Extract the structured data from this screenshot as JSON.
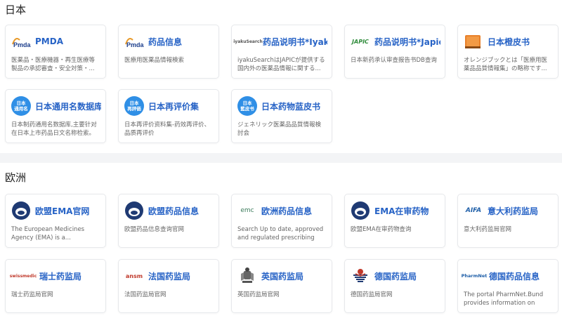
{
  "japan": {
    "title": "日本",
    "cards": [
      {
        "title": "PMDA",
        "desc": "医薬品・医療機器・再生医療等製品の承認審査・安全対策・...",
        "icon": "pmda-logo"
      },
      {
        "title": "药品信息",
        "desc": "医療用医薬品情報検索",
        "icon": "pmda-logo"
      },
      {
        "title": "药品说明书*Iyaku",
        "desc": "iyakuSearchはJAPICが提供する国内外の医薬品情報に関する...",
        "icon": "iyakusearch-logo",
        "logo_text": "iyakuSearch"
      },
      {
        "title": "药品说明书*Japic",
        "desc": "日本新药承认审查报告书DB查询",
        "icon": "japic-logo",
        "logo_text": "JAPIC"
      },
      {
        "title": "日本橙皮书",
        "desc": "オレンジブックとは「医療用医薬品品質情報集」の略称です...",
        "icon": "orange-book-logo"
      },
      {
        "title": "日本通用名数据库",
        "desc": "日本制药通用名数据库,主要针对在日本上市药品日文名称检索。",
        "icon": "generic-name-logo",
        "logo_text": "日本\n通用名"
      },
      {
        "title": "日本再评价集",
        "desc": "日本再评价资料集-药效再评价、品质再评价",
        "icon": "reevaluation-logo",
        "logo_text": "日本\n再評価"
      },
      {
        "title": "日本药物蓝皮书",
        "desc": "ジェネリック医薬品品質情報検討会",
        "icon": "blue-book-logo",
        "logo_text": "日本\n藍皮书"
      }
    ]
  },
  "europe": {
    "title": "欧洲",
    "cards": [
      {
        "title": "欧盟EMA官网",
        "desc": "The European Medicines Agency (EMA) is a...",
        "icon": "ema-logo"
      },
      {
        "title": "欧盟药品信息",
        "desc": "欧盟药品信息查询官网",
        "icon": "ema-logo"
      },
      {
        "title": "欧洲药品信息",
        "desc": "Search Up to date, approved and regulated prescribing an...",
        "icon": "emc-logo",
        "logo_text": "emc"
      },
      {
        "title": "EMA在审药物",
        "desc": "欧盟EMA在审药物查询",
        "icon": "ema-logo"
      },
      {
        "title": "意大利药监局",
        "desc": "意大利药监局官网",
        "icon": "aifa-logo",
        "logo_text": "AIFA"
      },
      {
        "title": "瑞士药监局",
        "desc": "瑞士药监局官网",
        "icon": "swissmedic-logo",
        "logo_text": "swissmedic"
      },
      {
        "title": "法国药监局",
        "desc": "法国药监局官网",
        "icon": "ansm-logo",
        "logo_text": "ansm"
      },
      {
        "title": "英国药监局",
        "desc": "英国药监局官网",
        "icon": "uk-crest-logo"
      },
      {
        "title": "德国药监局",
        "desc": "德国药监局官网",
        "icon": "bfarm-logo"
      },
      {
        "title": "德国药品信息",
        "desc": "The portal PharmNet.Bund provides information on dru...",
        "icon": "pharmnet-logo",
        "logo_text": "PharmNet"
      }
    ]
  },
  "colors": {
    "title_blue": "#2763c6",
    "pmda_blue": "#1d3f8c",
    "badge_blue": "#2f8fe6",
    "japic_green": "#2e8b3a",
    "orange": "#e8802a",
    "ema_navy": "#1f3a73"
  }
}
